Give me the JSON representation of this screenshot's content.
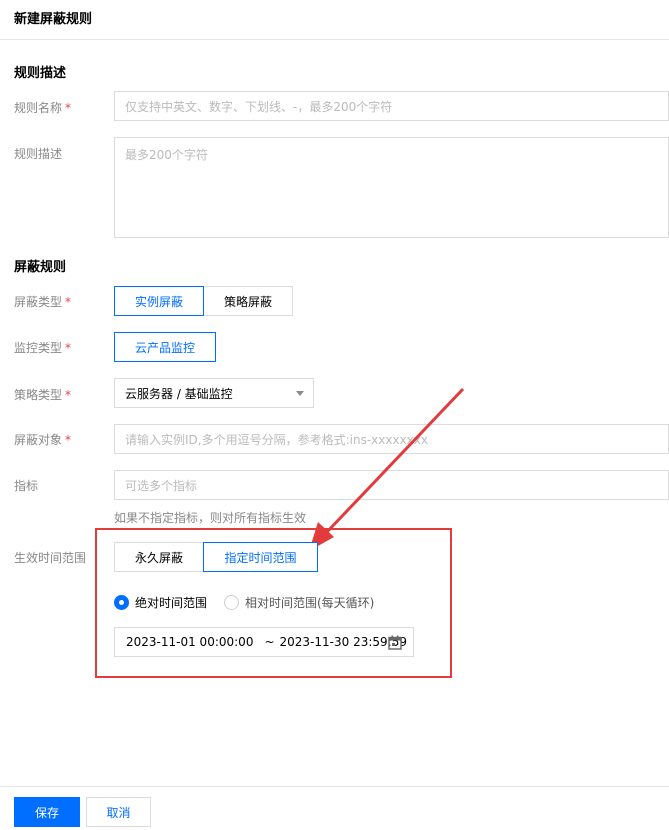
{
  "page": {
    "title": "新建屏蔽规则"
  },
  "rule_description": {
    "section_title": "规则描述",
    "name": {
      "label": "规则名称",
      "placeholder": "仅支持中英文、数字、下划线、-，最多200个字符"
    },
    "description": {
      "label": "规则描述",
      "placeholder": "最多200个字符"
    }
  },
  "shield_rule": {
    "section_title": "屏蔽规则",
    "shield_type": {
      "label": "屏蔽类型",
      "options": [
        "实例屏蔽",
        "策略屏蔽"
      ],
      "selected": "实例屏蔽"
    },
    "monitor_type": {
      "label": "监控类型",
      "options": [
        "云产品监控"
      ],
      "selected": "云产品监控"
    },
    "policy_type": {
      "label": "策略类型",
      "value": "云服务器 / 基础监控"
    },
    "shield_object": {
      "label": "屏蔽对象",
      "placeholder": "请输入实例ID,多个用逗号分隔，参考格式:ins-xxxxxxxx"
    },
    "metric": {
      "label": "指标",
      "placeholder": "可选多个指标",
      "hint": "如果不指定指标，则对所有指标生效"
    },
    "effective_time": {
      "label": "生效时间范围",
      "options": [
        "永久屏蔽",
        "指定时间范围"
      ],
      "selected": "指定时间范围",
      "range_modes": [
        "绝对时间范围",
        "相对时间范围(每天循环)"
      ],
      "range_mode_selected": "绝对时间范围",
      "start": "2023-11-01 00:00:00",
      "separator": "~",
      "end": "2023-11-30 23:59:59"
    }
  },
  "footer": {
    "save_label": "保存",
    "cancel_label": "取消"
  },
  "colors": {
    "primary": "#006eff",
    "required": "#e54545",
    "annotation": "#e33b3b"
  },
  "icons": {
    "calendar": "calendar-icon",
    "dropdown": "chevron-down-icon"
  }
}
